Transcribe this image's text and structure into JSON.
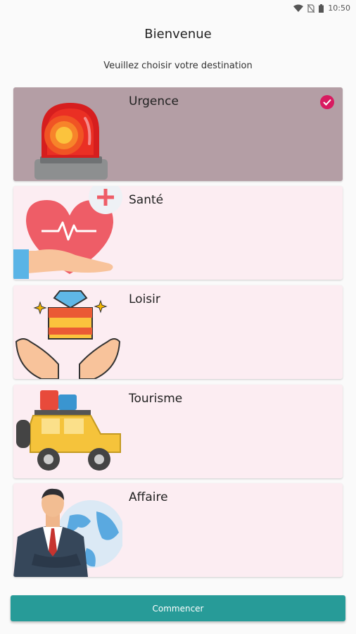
{
  "status": {
    "time": "10:50"
  },
  "header": {
    "title": "Bienvenue",
    "subtitle": "Veuillez choisir votre destination"
  },
  "destinations": [
    {
      "label": "Urgence",
      "icon": "siren-icon",
      "selected": true
    },
    {
      "label": "Santé",
      "icon": "health-heart-icon",
      "selected": false
    },
    {
      "label": "Loisir",
      "icon": "leisure-gift-icon",
      "selected": false
    },
    {
      "label": "Tourisme",
      "icon": "tourism-jeep-icon",
      "selected": false
    },
    {
      "label": "Affaire",
      "icon": "business-man-globe-icon",
      "selected": false
    }
  ],
  "actions": {
    "start_label": "Commencer"
  },
  "colors": {
    "selected_card": "#b49ea5",
    "card": "#fcedf2",
    "check": "#d81b60",
    "button": "#279b98"
  }
}
